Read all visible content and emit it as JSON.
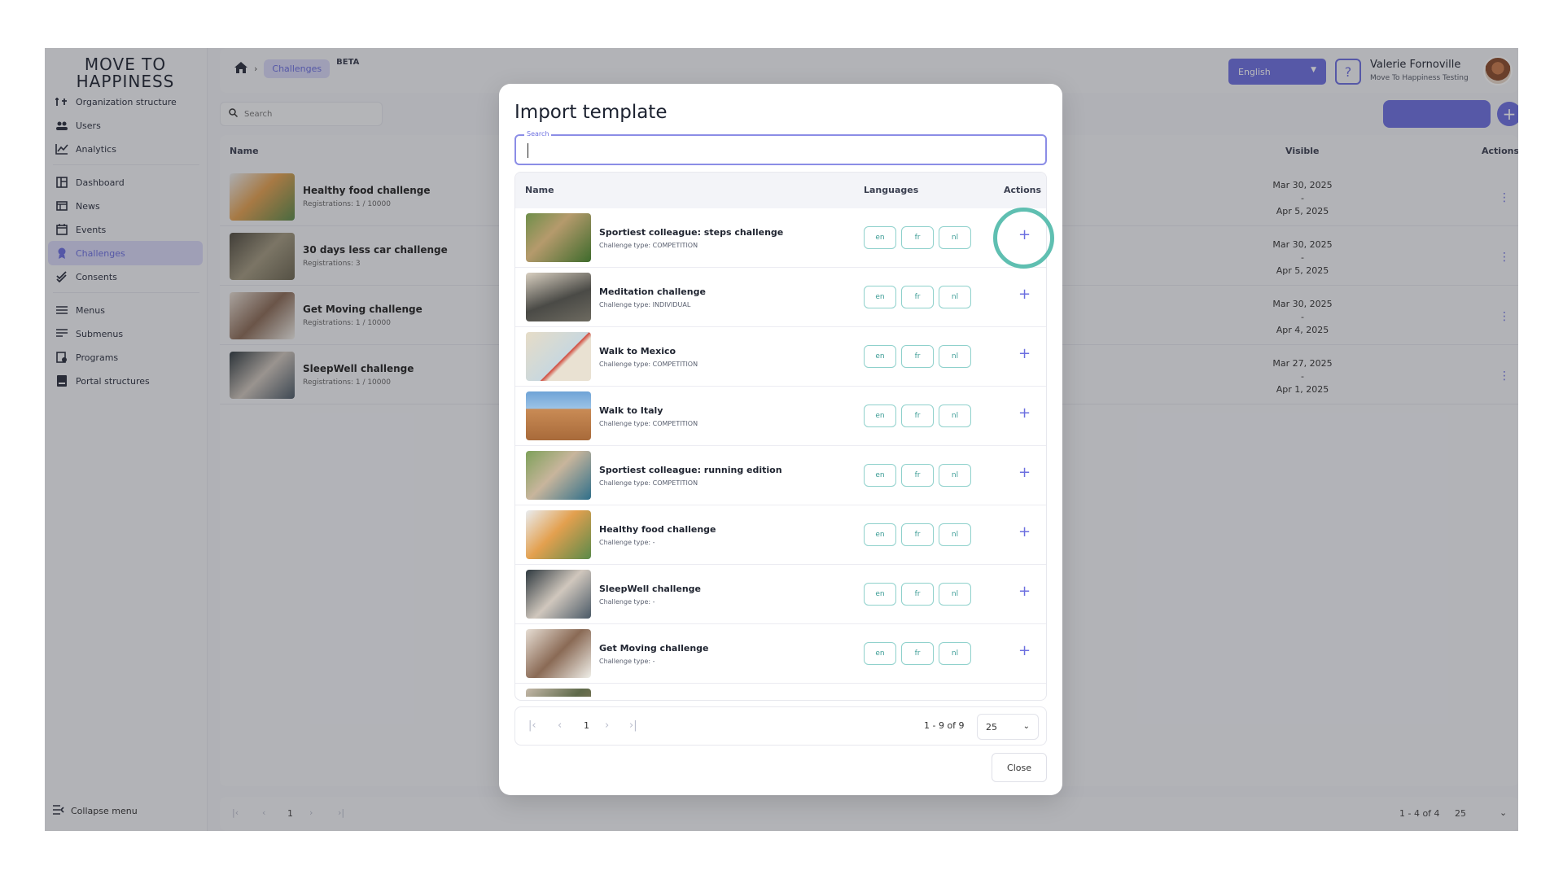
{
  "brand": {
    "logo_line1": "MOVE TO",
    "logo_line2": "HAPPINESS"
  },
  "sidebar": {
    "items": [
      {
        "label": "Organization structure",
        "icon": "org-structure-icon"
      },
      {
        "label": "Users",
        "icon": "users-icon"
      },
      {
        "label": "Analytics",
        "icon": "analytics-icon"
      },
      {
        "label": "Dashboard",
        "icon": "dashboard-icon"
      },
      {
        "label": "News",
        "icon": "news-icon"
      },
      {
        "label": "Events",
        "icon": "calendar-icon"
      },
      {
        "label": "Challenges",
        "icon": "challenge-icon",
        "active": true
      },
      {
        "label": "Consents",
        "icon": "check-icon"
      },
      {
        "label": "Menus",
        "icon": "menu-icon"
      },
      {
        "label": "Submenus",
        "icon": "submenu-icon"
      },
      {
        "label": "Programs",
        "icon": "programs-icon"
      },
      {
        "label": "Portal structures",
        "icon": "portal-icon"
      }
    ],
    "collapse_label": "Collapse menu"
  },
  "header": {
    "breadcrumb_current": "Challenges",
    "beta": "BETA",
    "language": "English",
    "help": "?",
    "user_name": "Valerie Fornoville",
    "user_org": "Move To Happiness Testing"
  },
  "main": {
    "search_placeholder": "Search",
    "columns": {
      "name": "Name",
      "visible": "Visible",
      "actions": "Actions"
    },
    "rows": [
      {
        "title": "Healthy food challenge",
        "sub": "Registrations: 1 / 10000",
        "from": "Mar 30, 2025",
        "dash": "-",
        "to": "Apr 5, 2025"
      },
      {
        "title": "30 days less car challenge",
        "sub": "Registrations: 3",
        "from": "Mar 30, 2025",
        "dash": "-",
        "to": "Apr 5, 2025"
      },
      {
        "title": "Get Moving challenge",
        "sub": "Registrations: 1 / 10000",
        "from": "Mar 30, 2025",
        "dash": "-",
        "to": "Apr 4, 2025"
      },
      {
        "title": "SleepWell challenge",
        "sub": "Registrations: 1 / 10000",
        "from": "Mar 27, 2025",
        "dash": "-",
        "to": "Apr 1, 2025"
      }
    ],
    "pager": {
      "page": "1",
      "range": "1 - 4 of 4",
      "size": "25"
    }
  },
  "modal": {
    "title": "Import template",
    "search_label": "Search",
    "columns": {
      "name": "Name",
      "languages": "Languages",
      "actions": "Actions"
    },
    "rows": [
      {
        "name": "Sportiest colleague: steps challenge",
        "type": "Challenge type: COMPETITION",
        "langs": [
          "en",
          "fr",
          "nl"
        ]
      },
      {
        "name": "Meditation challenge",
        "type": "Challenge type: INDIVIDUAL",
        "langs": [
          "en",
          "fr",
          "nl"
        ]
      },
      {
        "name": "Walk to Mexico",
        "type": "Challenge type: COMPETITION",
        "langs": [
          "en",
          "fr",
          "nl"
        ]
      },
      {
        "name": "Walk to Italy",
        "type": "Challenge type: COMPETITION",
        "langs": [
          "en",
          "fr",
          "nl"
        ]
      },
      {
        "name": "Sportiest colleague: running edition",
        "type": "Challenge type: COMPETITION",
        "langs": [
          "en",
          "fr",
          "nl"
        ]
      },
      {
        "name": "Healthy food challenge",
        "type": "Challenge type: -",
        "langs": [
          "en",
          "fr",
          "nl"
        ]
      },
      {
        "name": "SleepWell challenge",
        "type": "Challenge type: -",
        "langs": [
          "en",
          "fr",
          "nl"
        ]
      },
      {
        "name": "Get Moving challenge",
        "type": "Challenge type: -",
        "langs": [
          "en",
          "fr",
          "nl"
        ]
      }
    ],
    "pager": {
      "page": "1",
      "range": "1 - 9 of 9",
      "size": "25"
    },
    "close_label": "Close"
  },
  "colors": {
    "accent": "#6c6fe0",
    "teal": "#5fbfb1"
  }
}
